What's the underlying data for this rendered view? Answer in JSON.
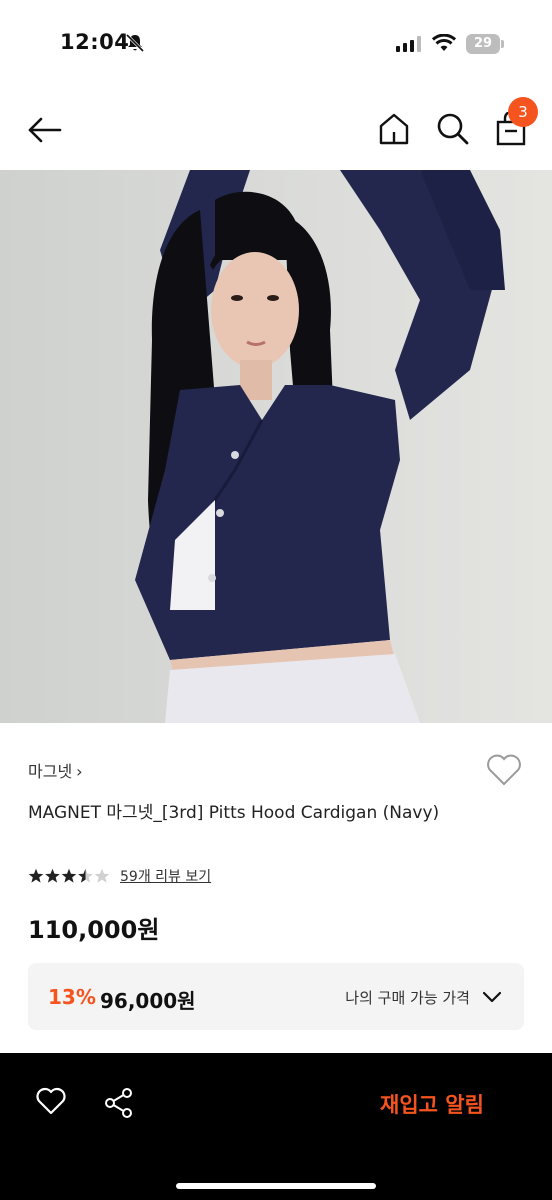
{
  "status_bar": {
    "time": "12:04",
    "battery": "29"
  },
  "nav": {
    "cart_count": "3"
  },
  "product": {
    "brand": "마그넷",
    "brand_chevron": "›",
    "title": "MAGNET 마그넷_[3rd] Pitts Hood Cardigan (Navy)",
    "rating": 3.5,
    "review_link": "59개 리뷰 보기",
    "price": "110,000원"
  },
  "price_box": {
    "discount_rate": "13%",
    "discount_price": "96,000원",
    "my_price_label": "나의 구매 가능 가격"
  },
  "bottom_bar": {
    "restock_label": "재입고 알림"
  },
  "colors": {
    "accent": "#f6541f",
    "hero_background": "#d7d8d5",
    "garment": "#22264e"
  }
}
